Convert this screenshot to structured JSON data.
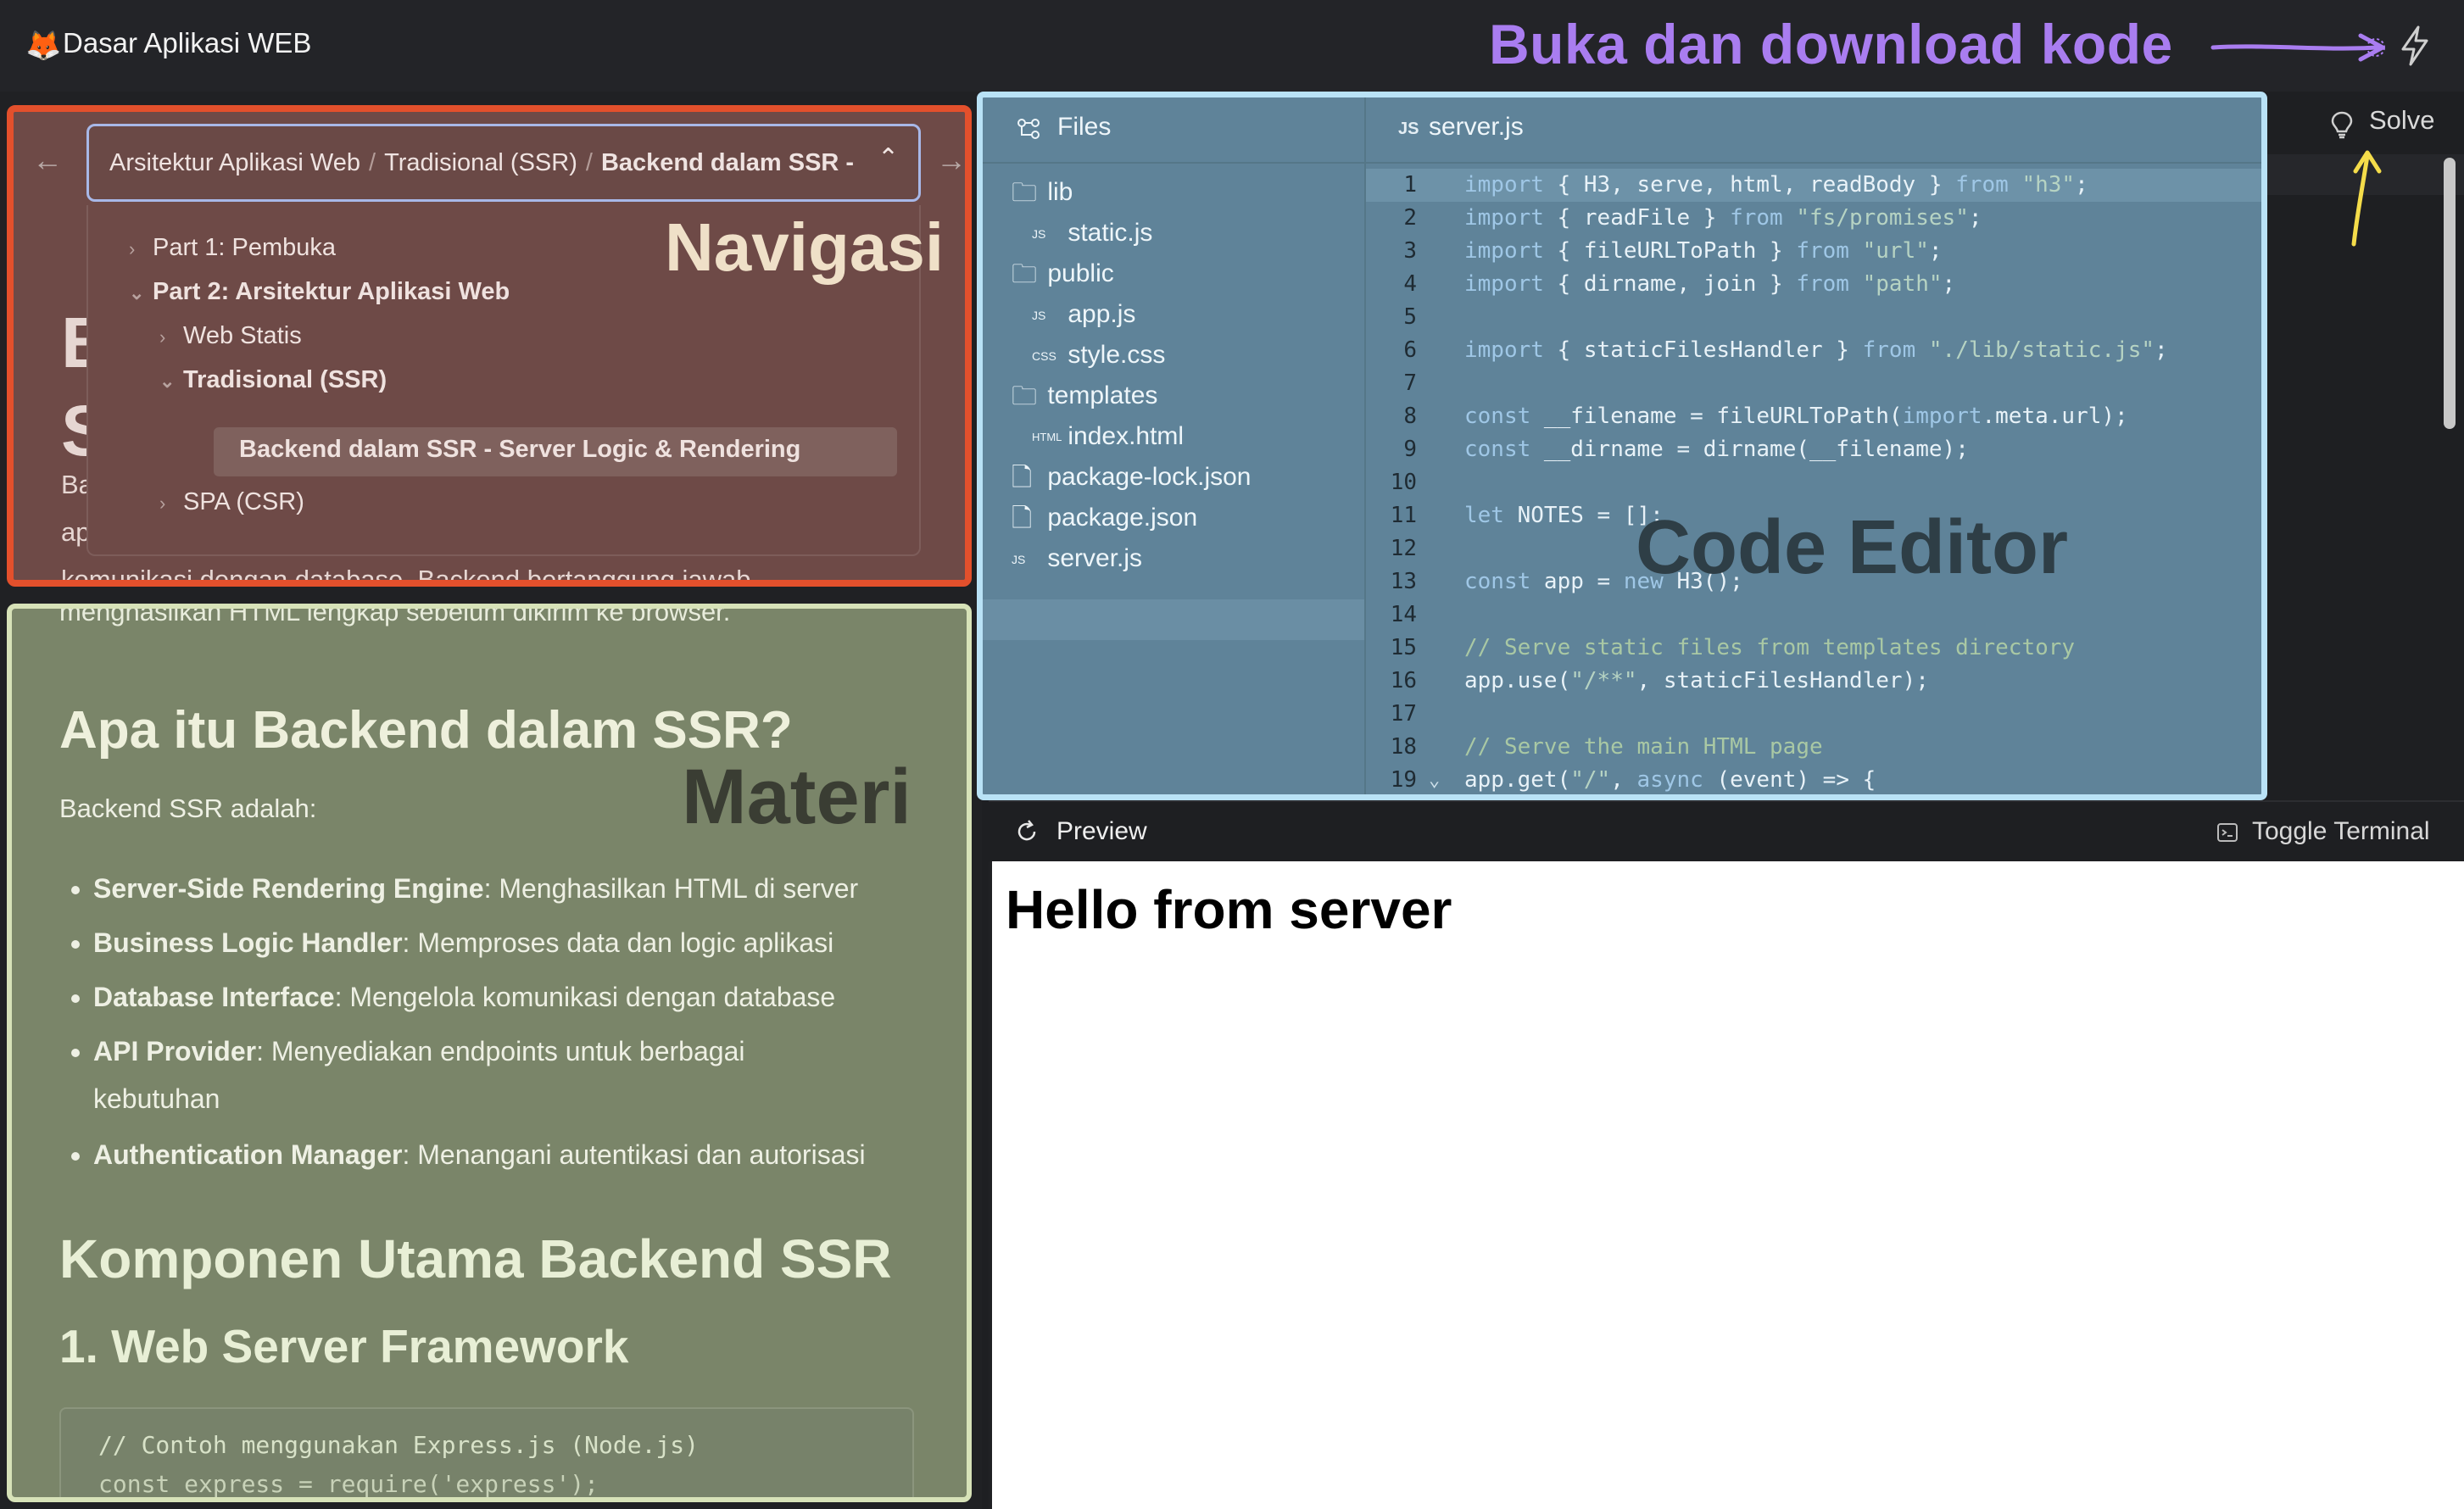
{
  "app": {
    "logo": "🦊",
    "title": "Dasar Aplikasi WEB"
  },
  "annotations": {
    "buka": "Buka dan download kode",
    "navigasi": "Navigasi",
    "materi": "Materi",
    "code_editor": "Code Editor"
  },
  "nav": {
    "prev": "←",
    "next": "→",
    "breadcrumb": [
      "Arsitektur Aplikasi Web",
      "Tradisional (SSR)",
      "Backend dalam SSR - Server Logic & Rendering"
    ],
    "separator": "/",
    "collapse_chevron": "⌃",
    "toc": {
      "part1": "Part 1: Pembuka",
      "part2": "Part 2: Arsitektur Aplikasi Web",
      "web_statis": "Web Statis",
      "tradisional": "Tradisional (SSR)",
      "backend": "Backend dalam SSR - Server Logic & Rendering",
      "spa": "SPA (CSR)"
    }
  },
  "content": {
    "hidden_letters": "B\nS",
    "hidden_para": "Ba\nap\nkomunikasi dengan database. Backend bertanggung jawab",
    "top_line": "menghasilkan HTML lengkap sebelum dikirim ke browser.",
    "h_apa": "Apa itu Backend dalam SSR?",
    "p_backend": "Backend SSR adalah:",
    "bullets": [
      {
        "term": "Server-Side Rendering Engine",
        "desc": ": Menghasilkan HTML di server"
      },
      {
        "term": "Business Logic Handler",
        "desc": ": Memproses data dan logic aplikasi"
      },
      {
        "term": "Database Interface",
        "desc": ": Mengelola komunikasi dengan database"
      },
      {
        "term": "API Provider",
        "desc": ": Menyediakan endpoints untuk berbagai kebutuhan"
      },
      {
        "term": "Authentication Manager",
        "desc": ": Menangani autentikasi dan autorisasi"
      }
    ],
    "h_komponen": "Komponen Utama Backend SSR",
    "h_web": "1. Web Server Framework",
    "code_comment": "// Contoh menggunakan Express.js (Node.js)",
    "code_line2": "const express = require('express');"
  },
  "files": {
    "title": "Files",
    "tree": [
      "lib",
      "static.js",
      "public",
      "app.js",
      "style.css",
      "templates",
      "index.html",
      "package-lock.json",
      "package.json",
      "server.js"
    ],
    "selected": "server.js"
  },
  "editor": {
    "tab_icon": "JS",
    "tab_name": "server.js",
    "line_numbers": [
      "1",
      "2",
      "3",
      "4",
      "5",
      "6",
      "7",
      "8",
      "9",
      "10",
      "11",
      "12",
      "13",
      "14",
      "15",
      "16",
      "17",
      "18",
      "19"
    ],
    "lines": [
      "import { H3, serve, html, readBody } from \"h3\";",
      "import { readFile } from \"fs/promises\";",
      "import { fileURLToPath } from \"url\";",
      "import { dirname, join } from \"path\";",
      "",
      "import { staticFilesHandler } from \"./lib/static.js\";",
      "",
      "const __filename = fileURLToPath(import.meta.url);",
      "const __dirname = dirname(__filename);",
      "",
      "let NOTES = [];",
      "",
      "const app = new H3();",
      "",
      "// Serve static files from templates directory",
      "app.use(\"/**\", staticFilesHandler);",
      "",
      "// Serve the main HTML page",
      "app.get(\"/\", async (event) => {"
    ]
  },
  "toolbar": {
    "solve": "Solve"
  },
  "preview": {
    "title": "Preview",
    "toggle_terminal": "Toggle Terminal",
    "heading": "Hello from server"
  }
}
